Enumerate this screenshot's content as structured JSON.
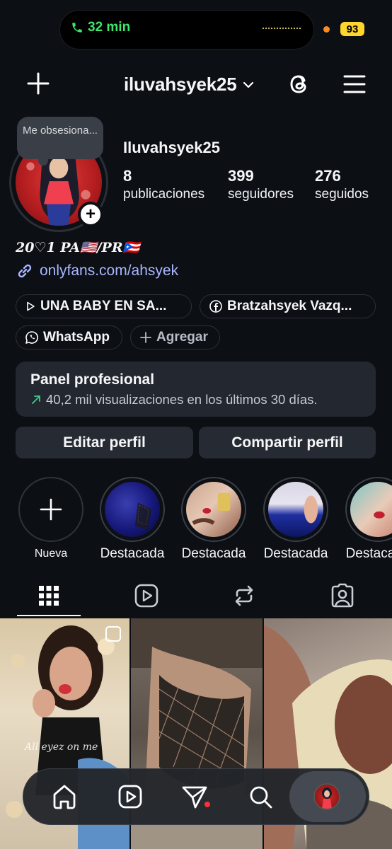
{
  "status_bar": {
    "call_duration": "32 min",
    "battery": "93"
  },
  "header": {
    "username": "iluvahsyek25"
  },
  "profile": {
    "note": "Me obsesiona...",
    "display_name": "Iluvahsyek25",
    "stats": [
      {
        "value": "8",
        "label": "publicaciones"
      },
      {
        "value": "399",
        "label": "seguidores"
      },
      {
        "value": "276",
        "label": "seguidos"
      }
    ],
    "bio": "20♡1 PA🇺🇸/PR🇵🇷",
    "link": "onlyfans.com/ahsyek",
    "chips": [
      {
        "label": "UNA BABY EN SA...",
        "icon": "play-icon"
      },
      {
        "label": "Bratzahsyek Vazq...",
        "icon": "facebook-icon"
      },
      {
        "label": "WhatsApp",
        "icon": "whatsapp-icon"
      },
      {
        "label": "Agregar",
        "icon": "plus-icon"
      }
    ]
  },
  "panel": {
    "title": "Panel profesional",
    "subtitle": "40,2 mil visualizaciones en los últimos 30 días."
  },
  "actions": {
    "edit": "Editar perfil",
    "share": "Compartir perfil"
  },
  "highlights": [
    {
      "label": "Nueva"
    },
    {
      "label": "Destacada"
    },
    {
      "label": "Destacada"
    },
    {
      "label": "Destacada"
    },
    {
      "label": "Destacada"
    }
  ],
  "tabs": [
    "grid-icon",
    "reels-icon",
    "reposts-icon",
    "tagged-icon"
  ],
  "grid_caption": "All eyez on me",
  "nav": [
    "home-icon",
    "reels-icon",
    "direct-icon",
    "search-icon",
    "profile-avatar"
  ],
  "colors": {
    "link": "#a9b6ff",
    "call": "#3ee66a",
    "battery": "#ffd62c",
    "notification": "#ff2e3c"
  }
}
